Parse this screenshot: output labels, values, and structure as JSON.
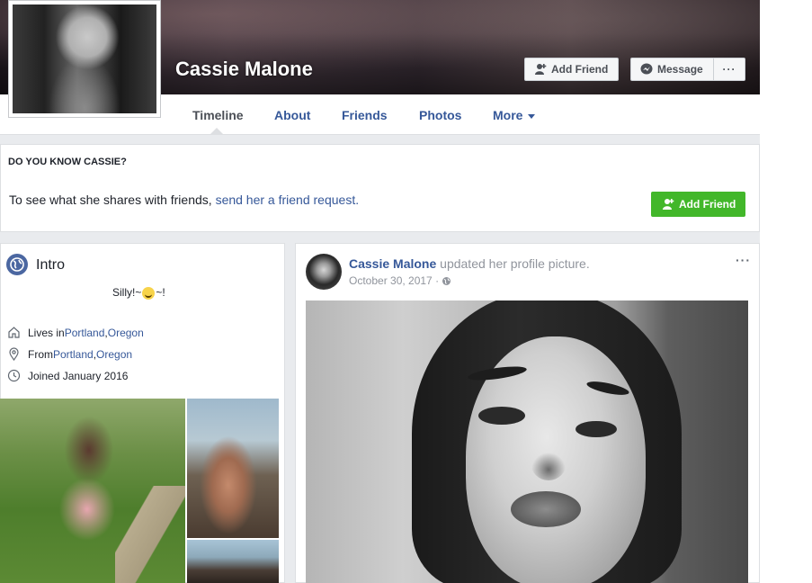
{
  "profile": {
    "name": "Cassie Malone",
    "add_friend_label": "Add Friend",
    "message_label": "Message",
    "more_label": "···"
  },
  "nav": {
    "items": [
      {
        "label": "Timeline",
        "active": true
      },
      {
        "label": "About"
      },
      {
        "label": "Friends"
      },
      {
        "label": "Photos"
      },
      {
        "label": "More"
      }
    ]
  },
  "know": {
    "title": "DO YOU KNOW CASSIE?",
    "text_prefix": "To see what she shares with friends, ",
    "link": "send her a friend request.",
    "button_label": "Add Friend"
  },
  "intro": {
    "title": "Intro",
    "bio_before": "Silly!~",
    "bio_after": "~!",
    "lives_prefix": "Lives in ",
    "lives_city": "Portland",
    "lives_sep": ", ",
    "lives_state": "Oregon",
    "from_prefix": "From ",
    "from_city": "Portland",
    "from_sep": ", ",
    "from_state": "Oregon",
    "joined": "Joined January 2016"
  },
  "post": {
    "author": "Cassie Malone",
    "action": " updated her profile picture.",
    "date": "October 30, 2017 · ",
    "options_label": "···"
  },
  "colors": {
    "link": "#365899",
    "green": "#42b72a",
    "page_bg": "#e9ebee"
  }
}
